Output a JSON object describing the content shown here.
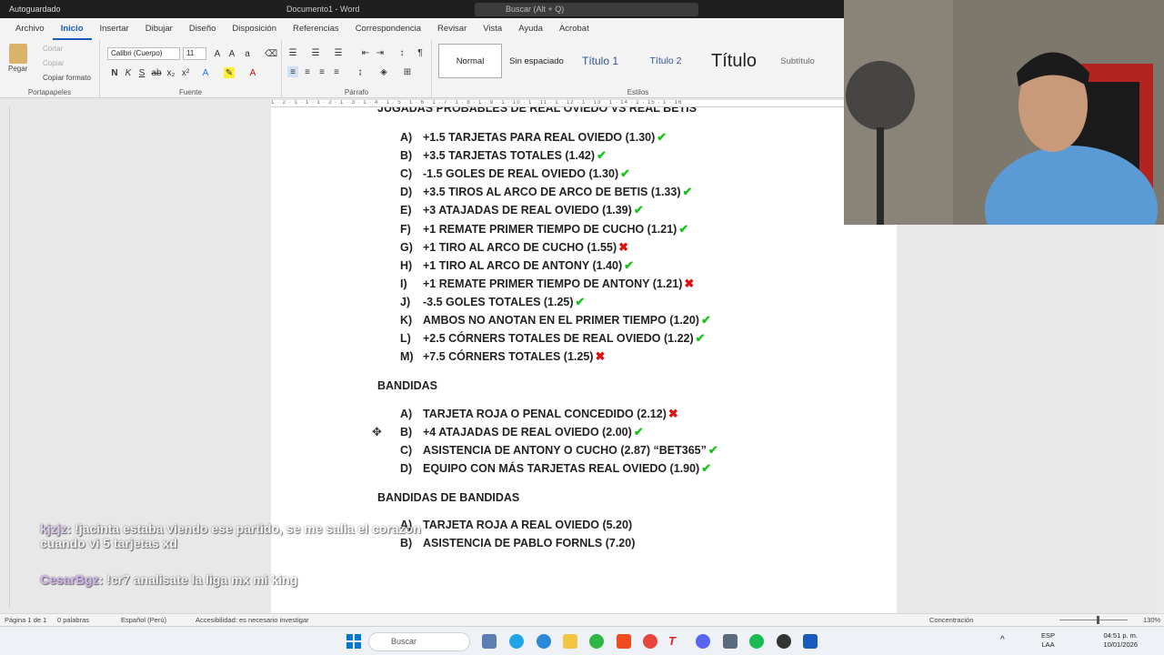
{
  "titlebar": {
    "autosave": "Autoguardado",
    "doc_title": "Documento1 - Word",
    "search_placeholder": "Buscar (Alt + Q)"
  },
  "menu_tabs": [
    "Archivo",
    "Inicio",
    "Insertar",
    "Dibujar",
    "Diseño",
    "Disposición",
    "Referencias",
    "Correspondencia",
    "Revisar",
    "Vista",
    "Ayuda",
    "Acrobat"
  ],
  "ribbon": {
    "clipboard": {
      "paste": "Pegar",
      "cut": "Cortar",
      "copy": "Copiar",
      "format_painter": "Copiar formato",
      "label": "Portapapeles"
    },
    "font": {
      "name": "Calibri (Cuerpo)",
      "size": "11",
      "label": "Fuente"
    },
    "paragraph": {
      "label": "Párrafo"
    },
    "styles": {
      "items": [
        "Normal",
        "Sin espaciado",
        "Título 1",
        "Título 2",
        "Título",
        "Subtítulo"
      ],
      "label": "Estilos"
    }
  },
  "ruler_text": "1 · 2 · 1 · 1 · 1 · 2 · 1 · 3 · 1 · 4 · 1 · 5 · 1 · 6 · 1 · 7 · 1 · 8 · 1 · 9 · 1 · 10 · 1 · 11 · 1 · 12 · 1 · 13 · 1 · 14 · 1 · 15 · 1 · 16",
  "document": {
    "heading_cut": "JUGADAS PROBABLES DE REAL OVIEDO VS REAL BETIS",
    "jugadas": [
      {
        "letter": "A)",
        "text": "+1.5 TARJETAS PARA REAL OVIEDO (1.30)",
        "ok": true
      },
      {
        "letter": "B)",
        "text": "+3.5 TARJETAS TOTALES (1.42)",
        "ok": true
      },
      {
        "letter": "C)",
        "text": "-1.5 GOLES DE REAL OVIEDO (1.30)",
        "ok": true
      },
      {
        "letter": "D)",
        "text": "+3.5 TIROS AL ARCO DE ARCO DE BETIS (1.33)",
        "ok": true
      },
      {
        "letter": "E)",
        "text": "+3 ATAJADAS DE REAL OVIEDO (1.39)",
        "ok": true
      },
      {
        "letter": "F)",
        "text": "+1 REMATE PRIMER TIEMPO DE CUCHO (1.21)",
        "ok": true
      },
      {
        "letter": "G)",
        "text": "+1 TIRO AL ARCO DE CUCHO (1.55)",
        "ok": false
      },
      {
        "letter": "H)",
        "text": "+1 TIRO AL ARCO DE ANTONY (1.40)",
        "ok": true
      },
      {
        "letter": "I)",
        "text": "+1 REMATE PRIMER TIEMPO DE ANTONY (1.21)",
        "ok": false
      },
      {
        "letter": "J)",
        "text": "-3.5 GOLES TOTALES (1.25)",
        "ok": true
      },
      {
        "letter": "K)",
        "text": "AMBOS NO ANOTAN EN EL PRIMER TIEMPO (1.20)",
        "ok": true
      },
      {
        "letter": "L)",
        "text": "+2.5 CÓRNERS TOTALES DE REAL OVIEDO (1.22)",
        "ok": true
      },
      {
        "letter": "M)",
        "text": "+7.5 CÓRNERS TOTALES (1.25)",
        "ok": false
      }
    ],
    "bandidas_title": "BANDIDAS",
    "bandidas": [
      {
        "letter": "A)",
        "text": "TARJETA ROJA O PENAL CONCEDIDO (2.12)",
        "ok": false
      },
      {
        "letter": "B)",
        "text": "+4 ATAJADAS DE REAL OVIEDO (2.00)",
        "ok": true
      },
      {
        "letter": "C)",
        "text": "ASISTENCIA DE ANTONY O CUCHO (2.87) “BET365”",
        "ok": true
      },
      {
        "letter": "D)",
        "text": "EQUIPO CON MÁS TARJETAS REAL OVIEDO (1.90)",
        "ok": true
      }
    ],
    "bdb_title": "BANDIDAS DE BANDIDAS",
    "bdb": [
      {
        "letter": "A)",
        "text": "TARJETA ROJA A REAL OVIEDO (5.20)"
      },
      {
        "letter": "B)",
        "text": "ASISTENCIA DE PABLO FORNLS (7.20)"
      }
    ]
  },
  "marks": {
    "ok": "✔",
    "bad": "✖"
  },
  "chat": [
    {
      "user": "kjzjz",
      "text": "!jacinta estaba viendo ese partido, se me salia el corazon",
      "text2": "cuando vi 5 tarjetas xd"
    },
    {
      "user": "CesarBgz",
      "text": "!cr7 analisate la liga mx mi king"
    }
  ],
  "status": {
    "page": "Página 1 de 1",
    "words": "0 palabras",
    "lang": "Español (Perú)",
    "access": "Accesibilidad: es necesario investigar",
    "focus": "Concentración",
    "zoom": "130%"
  },
  "taskbar": {
    "search": "Buscar",
    "lang1": "ESP",
    "lang2": "LAA",
    "time": "04:51 p. m.",
    "date": "10/01/2026"
  }
}
